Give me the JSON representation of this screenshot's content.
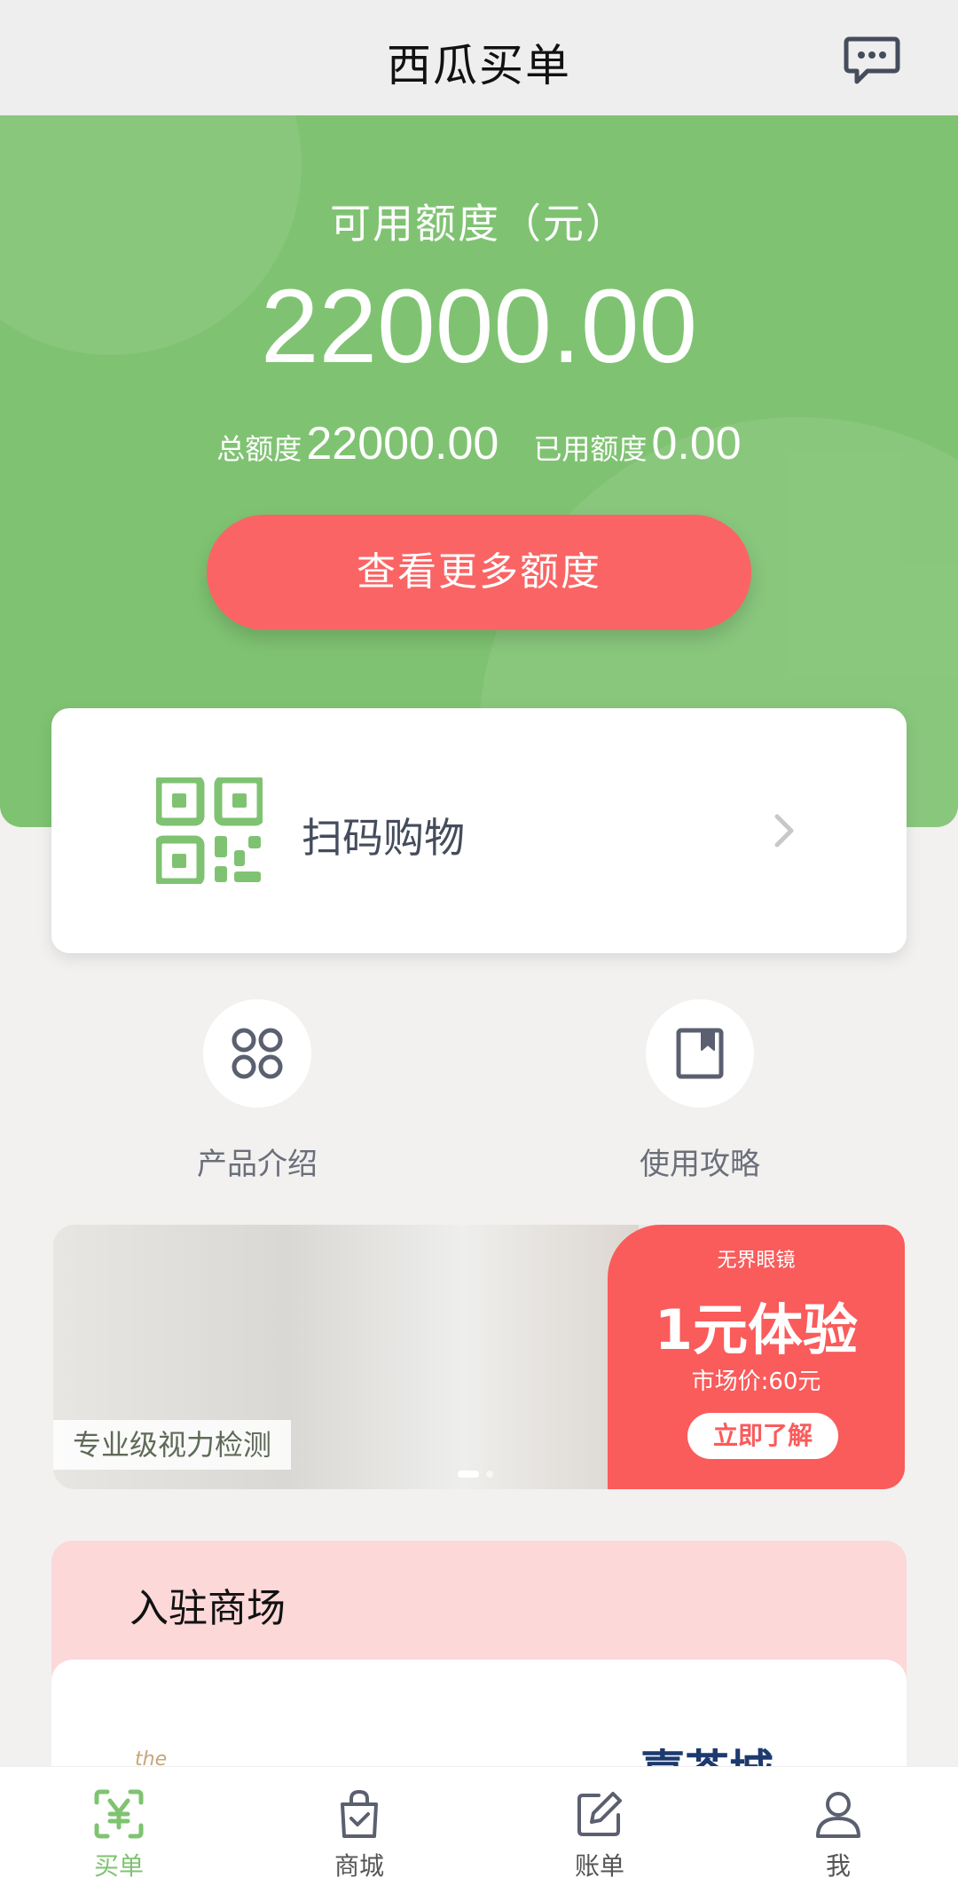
{
  "header": {
    "title": "西瓜买单",
    "message_icon": "chat-bubble-icon"
  },
  "credit": {
    "label": "可用额度（元）",
    "available": "22000.00",
    "total_label": "总额度",
    "total": "22000.00",
    "used_label": "已用额度",
    "used": "0.00",
    "more_button": "查看更多额度"
  },
  "scan": {
    "label": "扫码购物",
    "icon": "qr-code-icon"
  },
  "features": [
    {
      "label": "产品介绍",
      "icon": "grid-clover-icon"
    },
    {
      "label": "使用攻略",
      "icon": "book-icon"
    }
  ],
  "banner": {
    "caption": "专业级视力检测",
    "brand": "无界眼镜",
    "headline": "1元体验",
    "price": "市场价:60元",
    "cta": "立即了解"
  },
  "mall": {
    "title": "入驻商场",
    "partner_left": "the",
    "partner_right": "嘉茶城"
  },
  "tabbar": [
    {
      "label": "买单",
      "icon": "yuan-scan-icon",
      "active": true
    },
    {
      "label": "商城",
      "icon": "shopping-bag-icon",
      "active": false
    },
    {
      "label": "账单",
      "icon": "edit-icon",
      "active": false
    },
    {
      "label": "我",
      "icon": "user-icon",
      "active": false
    }
  ],
  "colors": {
    "brand_green": "#7fc372",
    "accent_red": "#fb6464",
    "text_gray": "#454c5c"
  }
}
